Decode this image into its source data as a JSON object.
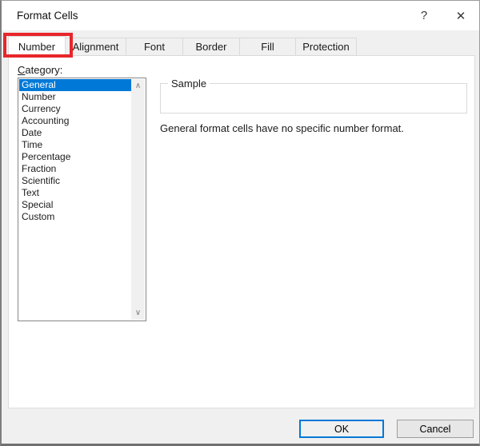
{
  "window": {
    "title": "Format Cells",
    "help_icon": "?",
    "close_icon": "✕"
  },
  "tabs": [
    {
      "label": "Number",
      "active": true,
      "annotated": true
    },
    {
      "label": "Alignment",
      "active": false
    },
    {
      "label": "Font",
      "active": false
    },
    {
      "label": "Border",
      "active": false
    },
    {
      "label": "Fill",
      "active": false
    },
    {
      "label": "Protection",
      "active": false
    }
  ],
  "category": {
    "label_mnemonic": "C",
    "label_rest": "ategory:",
    "items": [
      "General",
      "Number",
      "Currency",
      "Accounting",
      "Date",
      "Time",
      "Percentage",
      "Fraction",
      "Scientific",
      "Text",
      "Special",
      "Custom"
    ],
    "selected": "General",
    "scroll_up_icon": "∧",
    "scroll_down_icon": "∨"
  },
  "sample": {
    "label": "Sample",
    "value": ""
  },
  "description": "General format cells have no specific number format.",
  "buttons": {
    "ok_label": "OK",
    "cancel_label": "Cancel"
  },
  "colors": {
    "selection": "#0078d7",
    "annotation": "#e8262b",
    "ok_border": "#0078d7"
  }
}
